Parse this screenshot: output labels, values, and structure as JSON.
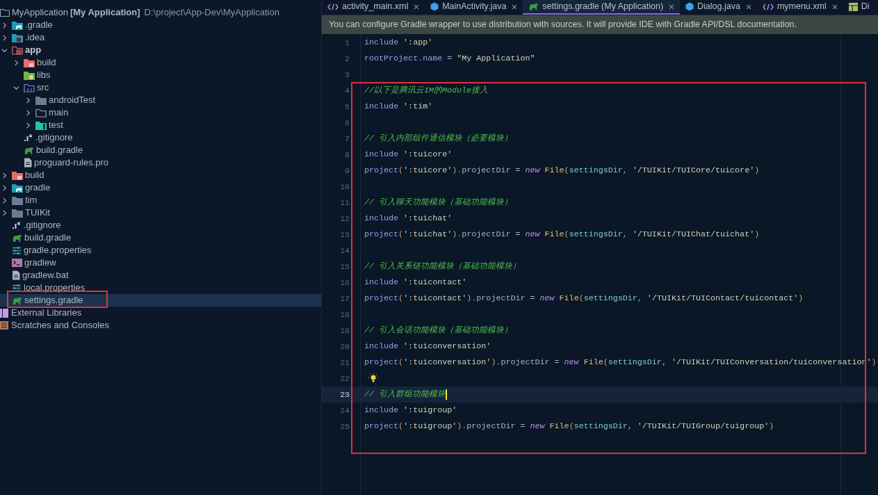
{
  "project_tree": {
    "root": {
      "name": "MyApplication",
      "module": "[My Application]",
      "path": "D:\\project\\App-Dev\\MyApplication"
    },
    "items": [
      {
        "label": ".gradle",
        "kind": "folder-gradle",
        "expanded": false,
        "selected": false,
        "bold": false
      },
      {
        "label": ".idea",
        "kind": "folder-idea",
        "expanded": false,
        "selected": false,
        "bold": false
      },
      {
        "label": "app",
        "kind": "module",
        "expanded": true,
        "selected": false,
        "bold": true,
        "children": [
          {
            "label": "build",
            "kind": "folder-build",
            "expanded": false,
            "selected": false,
            "bold": false
          },
          {
            "label": "libs",
            "kind": "folder-libs",
            "selected": false,
            "bold": false
          },
          {
            "label": "src",
            "kind": "folder-src",
            "expanded": true,
            "selected": false,
            "bold": false,
            "children": [
              {
                "label": "androidTest",
                "kind": "folder",
                "expanded": false,
                "selected": false,
                "bold": false
              },
              {
                "label": "main",
                "kind": "folder-outline",
                "expanded": false,
                "selected": false,
                "bold": false
              },
              {
                "label": "test",
                "kind": "folder-test",
                "expanded": false,
                "selected": false,
                "bold": false
              }
            ]
          },
          {
            "label": ".gitignore",
            "kind": "gitignore",
            "selected": false,
            "bold": false
          },
          {
            "label": "build.gradle",
            "kind": "gradle",
            "selected": false,
            "bold": false
          },
          {
            "label": "proguard-rules.pro",
            "kind": "file",
            "selected": false,
            "bold": false
          }
        ]
      },
      {
        "label": "build",
        "kind": "folder-build",
        "expanded": false,
        "selected": false,
        "bold": false
      },
      {
        "label": "gradle",
        "kind": "folder-gradle",
        "expanded": false,
        "selected": false,
        "bold": false
      },
      {
        "label": "tim",
        "kind": "folder",
        "expanded": false,
        "selected": false,
        "bold": false
      },
      {
        "label": "TUIKit",
        "kind": "folder",
        "expanded": false,
        "selected": false,
        "bold": false
      },
      {
        "label": ".gitignore",
        "kind": "gitignore",
        "selected": false,
        "bold": false
      },
      {
        "label": "build.gradle",
        "kind": "gradle",
        "selected": false,
        "bold": false
      },
      {
        "label": "gradle.properties",
        "kind": "properties",
        "selected": false,
        "bold": false
      },
      {
        "label": "gradlew",
        "kind": "terminal",
        "selected": false,
        "bold": false
      },
      {
        "label": "gradlew.bat",
        "kind": "file",
        "selected": false,
        "bold": false
      },
      {
        "label": "local.properties",
        "kind": "properties",
        "selected": false,
        "bold": false
      },
      {
        "label": "settings.gradle",
        "kind": "gradle",
        "selected": true,
        "bold": false
      }
    ],
    "footer_items": [
      {
        "label": "External Libraries",
        "kind": "libraries",
        "selected": false
      },
      {
        "label": "Scratches and Consoles",
        "kind": "scratches",
        "selected": false
      }
    ]
  },
  "tabs": [
    {
      "label": "activity_main.xml",
      "kind": "xml",
      "selected": false
    },
    {
      "label": "MainActivity.java",
      "kind": "java",
      "selected": false
    },
    {
      "label": "settings.gradle (My Application)",
      "kind": "gradle",
      "selected": true
    },
    {
      "label": "Dialog.java",
      "kind": "java",
      "selected": false
    },
    {
      "label": "mymenu.xml",
      "kind": "xml",
      "selected": false
    },
    {
      "label": "Di",
      "kind": "layout",
      "selected": false
    }
  ],
  "banner": "You can configure Gradle wrapper to use distribution with sources. It will provide IDE with Gradle API/DSL documentation.",
  "editor": {
    "lines": [
      {
        "n": "1",
        "current": false,
        "bulb": false,
        "tokens": [
          {
            "kind": "kw",
            "text": "include "
          },
          {
            "kind": "str",
            "text": "':app'"
          }
        ]
      },
      {
        "n": "2",
        "current": false,
        "bulb": false,
        "tokens": [
          {
            "kind": "kw",
            "text": "rootProject.name"
          },
          {
            "kind": "plain",
            "text": " = "
          },
          {
            "kind": "str",
            "text": "\"My Application\""
          }
        ]
      },
      {
        "n": "3",
        "current": false,
        "bulb": false
      },
      {
        "n": "4",
        "current": false,
        "bulb": false,
        "tokens": [
          {
            "kind": "comment",
            "text": "//以下是腾讯云IM的Module接入"
          }
        ]
      },
      {
        "n": "5",
        "current": false,
        "bulb": false,
        "tokens": [
          {
            "kind": "kw",
            "text": "include "
          },
          {
            "kind": "str",
            "text": "':tim'"
          }
        ]
      },
      {
        "n": "6",
        "current": false,
        "bulb": false
      },
      {
        "n": "7",
        "current": false,
        "bulb": false,
        "tokens": [
          {
            "kind": "comment",
            "text": "// 引入内部组件通信模块（必要模块）"
          }
        ]
      },
      {
        "n": "8",
        "current": false,
        "bulb": false,
        "tokens": [
          {
            "kind": "kw",
            "text": "include "
          },
          {
            "kind": "str",
            "text": "':tuicore'"
          }
        ]
      },
      {
        "n": "9",
        "current": false,
        "bulb": false,
        "tokens": [
          {
            "kind": "kw",
            "text": "project"
          },
          {
            "kind": "paren",
            "text": "("
          },
          {
            "kind": "str",
            "text": "':tuicore'"
          },
          {
            "kind": "paren",
            "text": ")"
          },
          {
            "kind": "plain",
            "text": ".projectDir = "
          },
          {
            "kind": "new",
            "text": "new"
          },
          {
            "kind": "cls",
            "text": " File"
          },
          {
            "kind": "paren",
            "text": "("
          },
          {
            "kind": "ident",
            "text": "settingsDir"
          },
          {
            "kind": "plain",
            "text": ", "
          },
          {
            "kind": "str",
            "text": "'/TUIKit/TUICore/tuicore'"
          },
          {
            "kind": "paren",
            "text": ")"
          }
        ]
      },
      {
        "n": "10",
        "current": false,
        "bulb": false
      },
      {
        "n": "11",
        "current": false,
        "bulb": false,
        "tokens": [
          {
            "kind": "comment",
            "text": "// 引入聊天功能模块（基础功能模块）"
          }
        ]
      },
      {
        "n": "12",
        "current": false,
        "bulb": false,
        "tokens": [
          {
            "kind": "kw",
            "text": "include "
          },
          {
            "kind": "str",
            "text": "':tuichat'"
          }
        ]
      },
      {
        "n": "13",
        "current": false,
        "bulb": false,
        "tokens": [
          {
            "kind": "kw",
            "text": "project"
          },
          {
            "kind": "paren",
            "text": "("
          },
          {
            "kind": "str",
            "text": "':tuichat'"
          },
          {
            "kind": "paren",
            "text": ")"
          },
          {
            "kind": "plain",
            "text": ".projectDir = "
          },
          {
            "kind": "new",
            "text": "new"
          },
          {
            "kind": "cls",
            "text": " File"
          },
          {
            "kind": "paren",
            "text": "("
          },
          {
            "kind": "ident",
            "text": "settingsDir"
          },
          {
            "kind": "plain",
            "text": ", "
          },
          {
            "kind": "str",
            "text": "'/TUIKit/TUIChat/tuichat'"
          },
          {
            "kind": "paren",
            "text": ")"
          }
        ]
      },
      {
        "n": "14",
        "current": false,
        "bulb": false
      },
      {
        "n": "15",
        "current": false,
        "bulb": false,
        "tokens": [
          {
            "kind": "comment",
            "text": "// 引入关系链功能模块（基础功能模块）"
          }
        ]
      },
      {
        "n": "16",
        "current": false,
        "bulb": false,
        "tokens": [
          {
            "kind": "kw",
            "text": "include "
          },
          {
            "kind": "str",
            "text": "':tuicontact'"
          }
        ]
      },
      {
        "n": "17",
        "current": false,
        "bulb": false,
        "tokens": [
          {
            "kind": "kw",
            "text": "project"
          },
          {
            "kind": "paren",
            "text": "("
          },
          {
            "kind": "str",
            "text": "':tuicontact'"
          },
          {
            "kind": "paren",
            "text": ")"
          },
          {
            "kind": "plain",
            "text": ".projectDir = "
          },
          {
            "kind": "new",
            "text": "new"
          },
          {
            "kind": "cls",
            "text": " File"
          },
          {
            "kind": "paren",
            "text": "("
          },
          {
            "kind": "ident",
            "text": "settingsDir"
          },
          {
            "kind": "plain",
            "text": ", "
          },
          {
            "kind": "str",
            "text": "'/TUIKit/TUIContact/tuicontact'"
          },
          {
            "kind": "paren",
            "text": ")"
          }
        ]
      },
      {
        "n": "18",
        "current": false,
        "bulb": false
      },
      {
        "n": "19",
        "current": false,
        "bulb": false,
        "tokens": [
          {
            "kind": "comment",
            "text": "// 引入会话功能模块（基础功能模块）"
          }
        ]
      },
      {
        "n": "20",
        "current": false,
        "bulb": false,
        "tokens": [
          {
            "kind": "kw",
            "text": "include "
          },
          {
            "kind": "str",
            "text": "':tuiconversation'"
          }
        ]
      },
      {
        "n": "21",
        "current": false,
        "bulb": false,
        "tokens": [
          {
            "kind": "kw",
            "text": "project"
          },
          {
            "kind": "paren",
            "text": "("
          },
          {
            "kind": "str",
            "text": "':tuiconversation'"
          },
          {
            "kind": "paren",
            "text": ")"
          },
          {
            "kind": "plain",
            "text": ".projectDir = "
          },
          {
            "kind": "new",
            "text": "new"
          },
          {
            "kind": "cls",
            "text": " File"
          },
          {
            "kind": "paren",
            "text": "("
          },
          {
            "kind": "ident",
            "text": "settingsDir"
          },
          {
            "kind": "plain",
            "text": ", "
          },
          {
            "kind": "str",
            "text": "'/TUIKit/TUIConversation/tuiconversation'"
          },
          {
            "kind": "paren",
            "text": ")"
          }
        ]
      },
      {
        "n": "22",
        "current": false,
        "bulb": true
      },
      {
        "n": "23",
        "current": true,
        "bulb": false,
        "tokens": [
          {
            "kind": "comment",
            "text": "// 引入群组功能模块"
          }
        ]
      },
      {
        "n": "24",
        "current": false,
        "bulb": false,
        "tokens": [
          {
            "kind": "kw",
            "text": "include "
          },
          {
            "kind": "str",
            "text": "':tuigroup'"
          }
        ]
      },
      {
        "n": "25",
        "current": false,
        "bulb": false,
        "tokens": [
          {
            "kind": "kw",
            "text": "project"
          },
          {
            "kind": "paren",
            "text": "("
          },
          {
            "kind": "str",
            "text": "':tuigroup'"
          },
          {
            "kind": "paren",
            "text": ")"
          },
          {
            "kind": "plain",
            "text": ".projectDir = "
          },
          {
            "kind": "new",
            "text": "new"
          },
          {
            "kind": "cls",
            "text": " File"
          },
          {
            "kind": "paren",
            "text": "("
          },
          {
            "kind": "ident",
            "text": "settingsDir"
          },
          {
            "kind": "plain",
            "text": ", "
          },
          {
            "kind": "str",
            "text": "'/TUIKit/TUIGroup/tuigroup'"
          },
          {
            "kind": "paren",
            "text": ")"
          }
        ]
      }
    ]
  }
}
